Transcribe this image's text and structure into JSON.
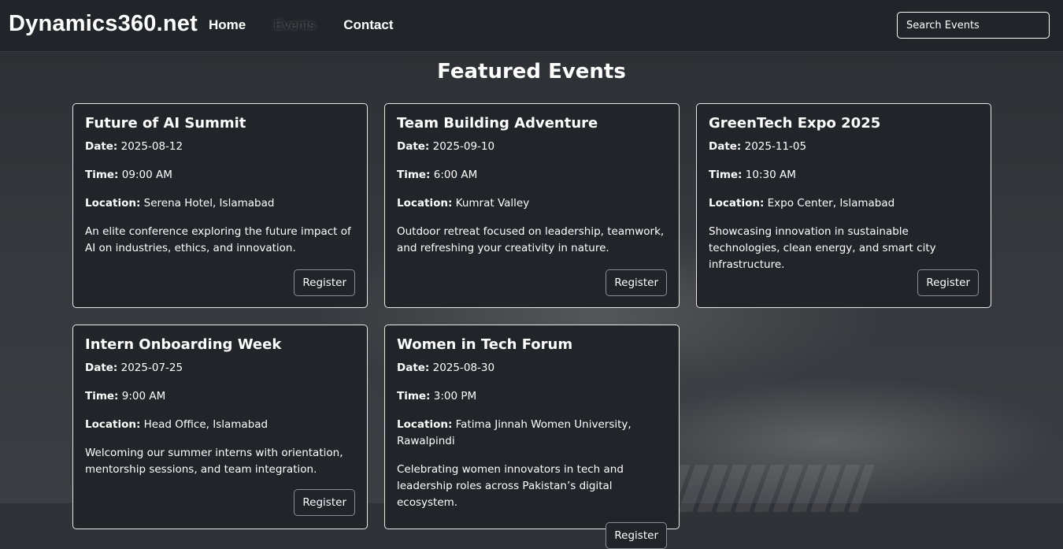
{
  "header": {
    "brand": "Dynamics360.net",
    "nav": [
      {
        "label": "Home"
      },
      {
        "label": "Events"
      },
      {
        "label": "Contact"
      }
    ],
    "search_placeholder": "Search Events"
  },
  "main": {
    "title": "Featured Events",
    "labels": {
      "date": "Date:",
      "time": "Time:",
      "location": "Location:"
    },
    "register_label": "Register",
    "events": [
      {
        "title": "Future of AI Summit",
        "date": "2025-08-12",
        "time": "09:00 AM",
        "location": "Serena Hotel, Islamabad",
        "description": "An elite conference exploring the future impact of AI on industries, ethics, and innovation."
      },
      {
        "title": "Team Building Adventure",
        "date": "2025-09-10",
        "time": "6:00 AM",
        "location": "Kumrat Valley",
        "description": "Outdoor retreat focused on leadership, teamwork, and refreshing your creativity in nature."
      },
      {
        "title": "GreenTech Expo 2025",
        "date": "2025-11-05",
        "time": "10:30 AM",
        "location": "Expo Center, Islamabad",
        "description": "Showcasing innovation in sustainable technologies, clean energy, and smart city infrastructure."
      },
      {
        "title": "Intern Onboarding Week",
        "date": "2025-07-25",
        "time": "9:00 AM",
        "location": "Head Office, Islamabad",
        "description": "Welcoming our summer interns with orientation, mentorship sessions, and team integration."
      },
      {
        "title": "Women in Tech Forum",
        "date": "2025-08-30",
        "time": "3:00 PM",
        "location": "Fatima Jinnah Women University, Rawalpindi",
        "description": "Celebrating women innovators in tech and leadership roles across Pakistan’s digital ecosystem."
      }
    ]
  }
}
